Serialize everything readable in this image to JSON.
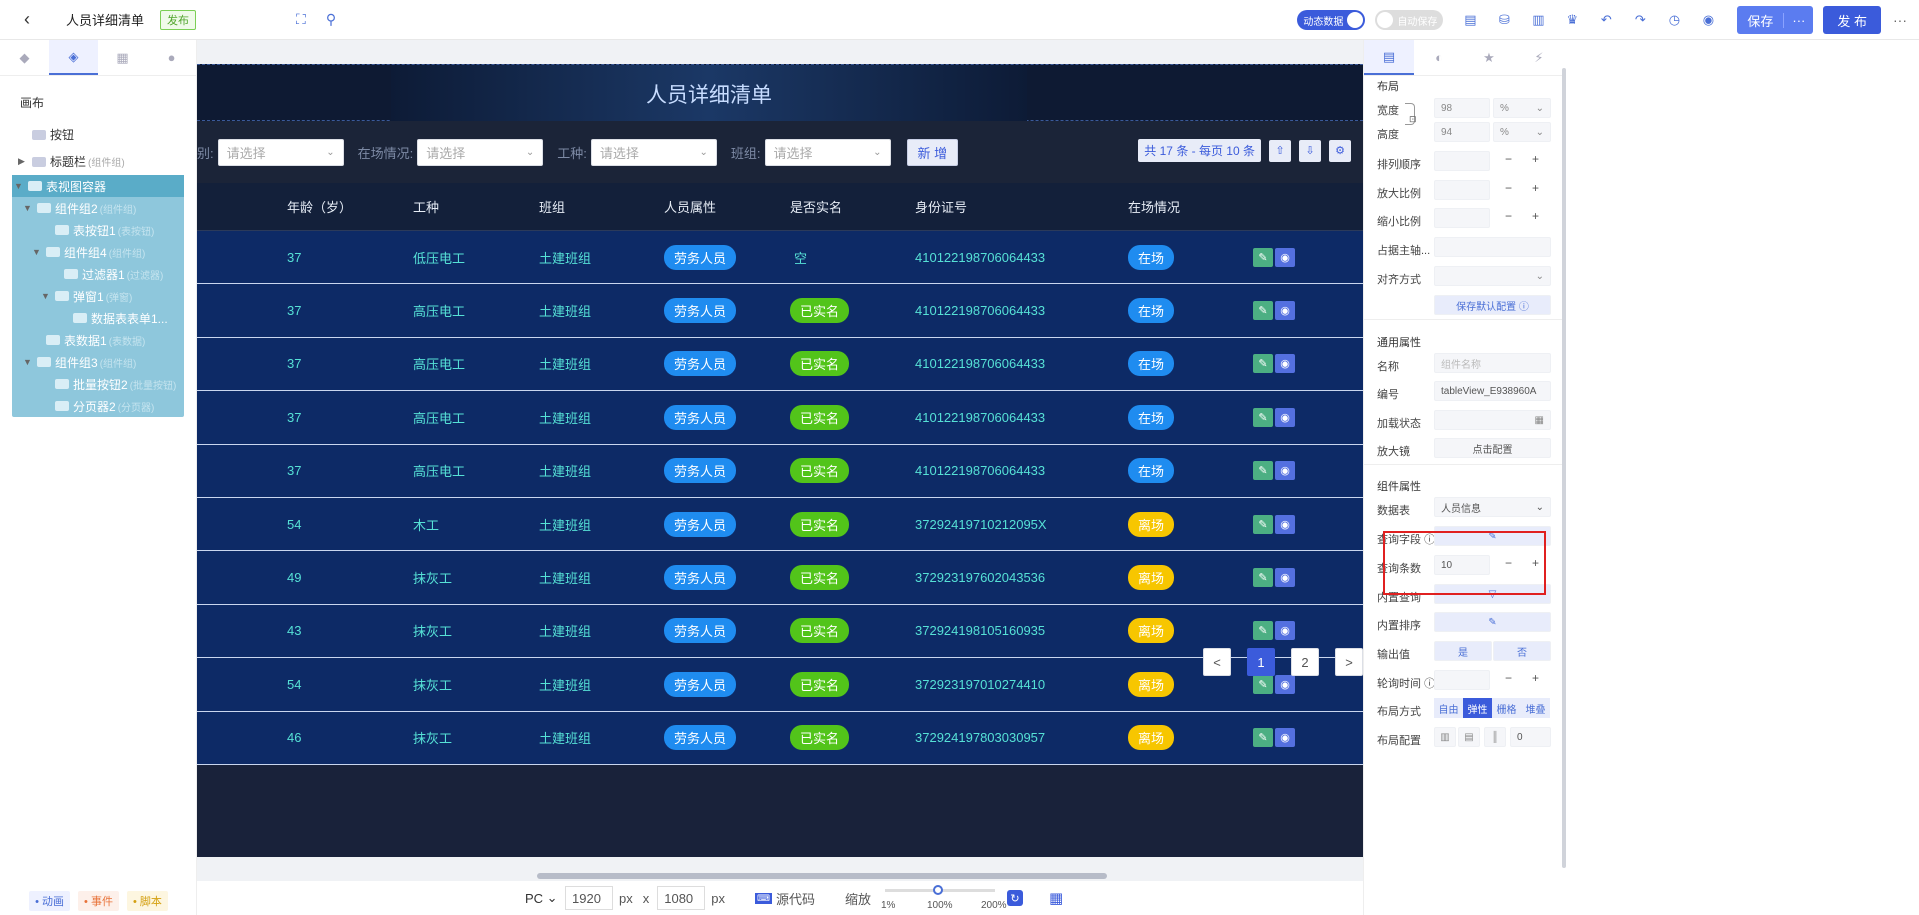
{
  "topbar": {
    "back_icon": "chevron-left-icon",
    "title": "人员详细清单",
    "publish_badge": "发布",
    "toggle_dynamic": "动态数据",
    "toggle_autosave": "自动保存",
    "save_label": "保存",
    "save_more": "···",
    "publish_label": "发 布",
    "more": "···"
  },
  "left_panel": {
    "canvas_label": "画布",
    "tree": [
      {
        "label": "按钮",
        "sub": "",
        "indent": 0,
        "arrow": ""
      },
      {
        "label": "标题栏",
        "sub": "(组件组)",
        "indent": 0,
        "arrow": "▶"
      }
    ],
    "selected_tree": [
      {
        "label": "表视图容器",
        "sub": "",
        "indent": 0,
        "arrow": "▼"
      },
      {
        "label": "组件组2",
        "sub": "(组件组)",
        "indent": 1,
        "arrow": "▼"
      },
      {
        "label": "表按钮1",
        "sub": "(表按钮)",
        "indent": 3,
        "arrow": ""
      },
      {
        "label": "组件组4",
        "sub": "(组件组)",
        "indent": 2,
        "arrow": "▼"
      },
      {
        "label": "过滤器1",
        "sub": "(过滤器)",
        "indent": 4,
        "arrow": ""
      },
      {
        "label": "弹窗1",
        "sub": "(弹窗)",
        "indent": 3,
        "arrow": "▼"
      },
      {
        "label": "数据表表单1...",
        "sub": "",
        "indent": 5,
        "arrow": ""
      },
      {
        "label": "表数据1",
        "sub": "(表数据)",
        "indent": 2,
        "arrow": ""
      },
      {
        "label": "组件组3",
        "sub": "(组件组)",
        "indent": 1,
        "arrow": "▼"
      },
      {
        "label": "批量按钮2",
        "sub": "(批量按钮)",
        "indent": 3,
        "arrow": ""
      },
      {
        "label": "分页器2",
        "sub": "(分页器)",
        "indent": 3,
        "arrow": ""
      }
    ],
    "footer": {
      "animation": "• 动画",
      "event": "• 事件",
      "script": "• 脚本"
    }
  },
  "canvas": {
    "header_title": "人员详细清单",
    "filters": [
      {
        "label": "别:",
        "placeholder": "请选择"
      },
      {
        "label": "在场情况:",
        "placeholder": "请选择"
      },
      {
        "label": "工种:",
        "placeholder": "请选择"
      },
      {
        "label": "班组:",
        "placeholder": "请选择"
      }
    ],
    "add_button": "新 增",
    "total_info": "共 17 条 - 每页 10 条",
    "columns": [
      "年龄（岁）",
      "工种",
      "班组",
      "人员属性",
      "是否实名",
      "身份证号",
      "在场情况"
    ],
    "rows": [
      {
        "age": "37",
        "type": "低压电工",
        "team": "土建班组",
        "attr": "劳务人员",
        "real": "空",
        "id": "410122198706064433",
        "status": "在场"
      },
      {
        "age": "37",
        "type": "高压电工",
        "team": "土建班组",
        "attr": "劳务人员",
        "real": "已实名",
        "id": "410122198706064433",
        "status": "在场"
      },
      {
        "age": "37",
        "type": "高压电工",
        "team": "土建班组",
        "attr": "劳务人员",
        "real": "已实名",
        "id": "410122198706064433",
        "status": "在场"
      },
      {
        "age": "37",
        "type": "高压电工",
        "team": "土建班组",
        "attr": "劳务人员",
        "real": "已实名",
        "id": "410122198706064433",
        "status": "在场"
      },
      {
        "age": "37",
        "type": "高压电工",
        "team": "土建班组",
        "attr": "劳务人员",
        "real": "已实名",
        "id": "410122198706064433",
        "status": "在场"
      },
      {
        "age": "54",
        "type": "木工",
        "team": "土建班组",
        "attr": "劳务人员",
        "real": "已实名",
        "id": "37292419710212095X",
        "status": "离场"
      },
      {
        "age": "49",
        "type": "抹灰工",
        "team": "土建班组",
        "attr": "劳务人员",
        "real": "已实名",
        "id": "372923197602043536",
        "status": "离场"
      },
      {
        "age": "43",
        "type": "抹灰工",
        "team": "土建班组",
        "attr": "劳务人员",
        "real": "已实名",
        "id": "372924198105160935",
        "status": "离场"
      },
      {
        "age": "54",
        "type": "抹灰工",
        "team": "土建班组",
        "attr": "劳务人员",
        "real": "已实名",
        "id": "372923197010274410",
        "status": "离场"
      },
      {
        "age": "46",
        "type": "抹灰工",
        "team": "土建班组",
        "attr": "劳务人员",
        "real": "已实名",
        "id": "372924197803030957",
        "status": "离场"
      }
    ],
    "pages": [
      "<",
      "1",
      "2",
      ">"
    ],
    "footer": {
      "device": "PC",
      "width": "1920",
      "height": "1080",
      "unit": "px",
      "x": "x",
      "source_code": "源代码",
      "zoom_label": "缩放",
      "zoom_min": "1%",
      "zoom_mid": "100%",
      "zoom_max": "200%"
    }
  },
  "right_panel": {
    "layout_title": "布局",
    "width_label": "宽度",
    "width_value": "98",
    "width_unit": "%",
    "height_label": "高度",
    "height_value": "94",
    "height_unit": "%",
    "order_label": "排列顺序",
    "zoom_in_label": "放大比例",
    "zoom_out_label": "缩小比例",
    "axis_label": "占据主轴...",
    "align_label": "对齐方式",
    "save_default": "保存默认配置",
    "common_title": "通用属性",
    "name_label": "名称",
    "name_placeholder": "组件名称",
    "code_label": "编号",
    "code_value": "tableView_E938960A",
    "loading_label": "加载状态",
    "magnifier_label": "放大镜",
    "magnifier_value": "点击配置",
    "component_title": "组件属性",
    "datasource_label": "数据表",
    "datasource_value": "人员信息",
    "query_field_label": "查询字段",
    "query_count_label": "查询条数",
    "query_count_value": "10",
    "builtin_query_label": "内置查询",
    "builtin_sort_label": "内置排序",
    "output_label": "输出值",
    "output_yes": "是",
    "output_no": "否",
    "poll_label": "轮询时间",
    "layout_mode_label": "布局方式",
    "layout_modes": [
      "自由",
      "弹性",
      "栅格",
      "堆叠"
    ],
    "layout_config_label": "布局配置",
    "layout_config_value": "0"
  },
  "colors": {
    "accent": "#3b5bdb",
    "tag_blue": "#1f8cf0",
    "tag_green": "#52c41a",
    "tag_yellow": "#f7c600",
    "row_bg": "#0d2a66",
    "row_text": "#56e1d6"
  }
}
